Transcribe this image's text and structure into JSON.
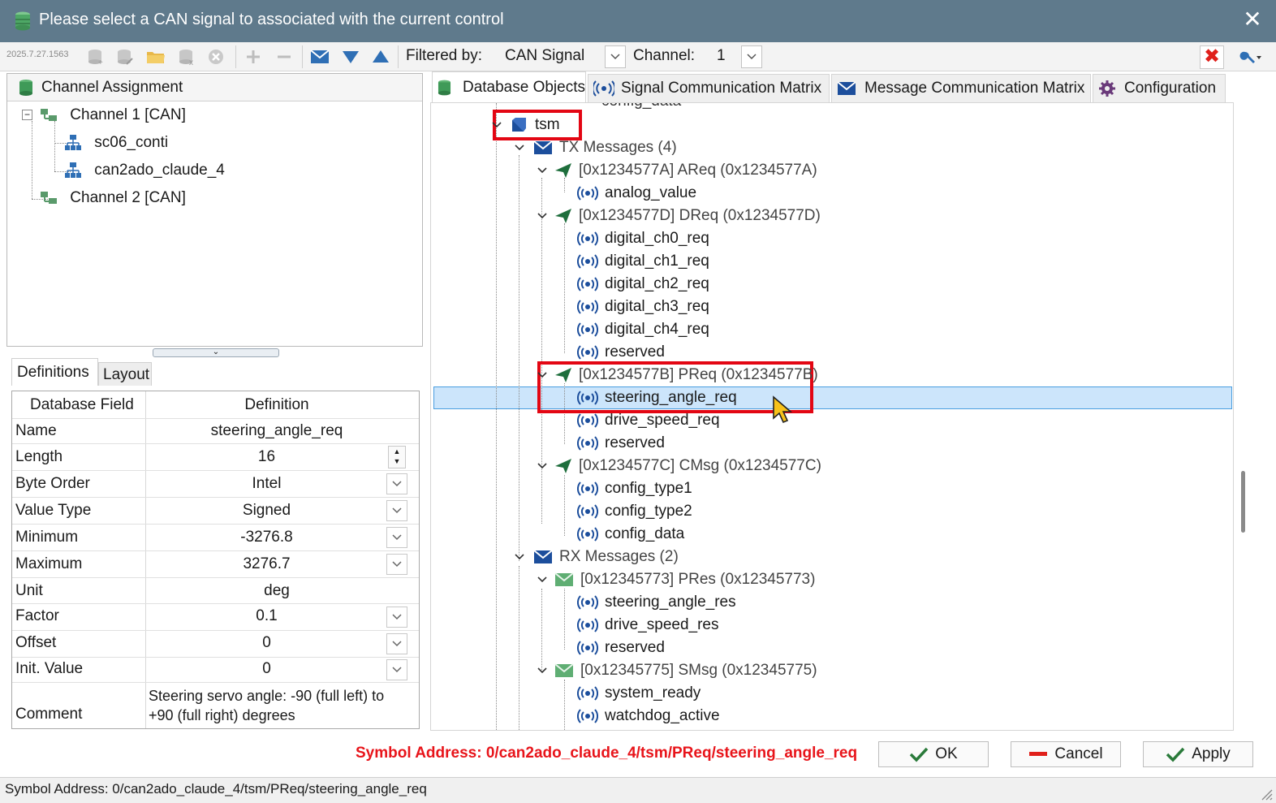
{
  "window": {
    "title": "Please select a CAN signal to associated with the current control",
    "close_glyph": "✕"
  },
  "toolbar": {
    "version": "2025.7.27.1563",
    "filtered_by_label": "Filtered by:",
    "filtered_by_value": "CAN Signal",
    "channel_label": "Channel:",
    "channel_value": "1",
    "clear_glyph": "✖"
  },
  "channel_assignment": {
    "title": "Channel Assignment",
    "items": [
      {
        "label": "Channel 1 [CAN]"
      },
      {
        "label": "sc06_conti"
      },
      {
        "label": "can2ado_claude_4"
      },
      {
        "label": "Channel 2 [CAN]"
      }
    ]
  },
  "left_tabs": {
    "definitions": "Definitions",
    "layout": "Layout"
  },
  "definitions": {
    "header_field": "Database Field",
    "header_definition": "Definition",
    "rows": [
      {
        "field": "Name",
        "value": "steering_angle_req"
      },
      {
        "field": "Length",
        "value": "16"
      },
      {
        "field": "Byte Order",
        "value": "Intel"
      },
      {
        "field": "Value Type",
        "value": "Signed"
      },
      {
        "field": "Minimum",
        "value": "-3276.8"
      },
      {
        "field": "Maximum",
        "value": "3276.7"
      },
      {
        "field": "Unit",
        "value": "deg"
      },
      {
        "field": "Factor",
        "value": "0.1"
      },
      {
        "field": "Offset",
        "value": "0"
      },
      {
        "field": "Init. Value",
        "value": "0"
      },
      {
        "field": "Comment",
        "value_line1": "Steering servo angle: -90 (full left) to",
        "value_line2": "+90 (full right) degrees"
      }
    ]
  },
  "right_tabs": [
    {
      "label": "Database Objects"
    },
    {
      "label": "Signal Communication Matrix"
    },
    {
      "label": "Message Communication Matrix"
    },
    {
      "label": "Configuration"
    }
  ],
  "tree": {
    "cut_top": "config_data",
    "node": "tsm",
    "tx": {
      "label": "TX Messages (4)",
      "messages": [
        {
          "label": "[0x1234577A] AReq (0x1234577A)",
          "signals": [
            "analog_value"
          ]
        },
        {
          "label": "[0x1234577D] DReq (0x1234577D)",
          "signals": [
            "digital_ch0_req",
            "digital_ch1_req",
            "digital_ch2_req",
            "digital_ch3_req",
            "digital_ch4_req",
            "reserved"
          ]
        },
        {
          "label": "[0x1234577B] PReq (0x1234577B)",
          "signals": [
            "steering_angle_req",
            "drive_speed_req",
            "reserved"
          ]
        },
        {
          "label": "[0x1234577C] CMsg (0x1234577C)",
          "signals": [
            "config_type1",
            "config_type2",
            "config_data"
          ]
        }
      ]
    },
    "rx": {
      "label": "RX Messages (2)",
      "messages": [
        {
          "label": "[0x12345773] PRes (0x12345773)",
          "signals": [
            "steering_angle_res",
            "drive_speed_res",
            "reserved"
          ]
        },
        {
          "label": "[0x12345775] SMsg (0x12345775)",
          "signals": [
            "system_ready",
            "watchdog_active"
          ]
        }
      ]
    }
  },
  "bottom": {
    "symbol_address": "Symbol Address: 0/can2ado_claude_4/tsm/PReq/steering_angle_req",
    "ok_label": "OK",
    "cancel_label": "Cancel",
    "apply_label": "Apply"
  },
  "statusbar": {
    "text": "Symbol Address: 0/can2ado_claude_4/tsm/PReq/steering_angle_req"
  },
  "colors": {
    "titlebar": "#5f7a8c",
    "selection": "#cce5fb",
    "highlight_box": "#e30613",
    "symbol_address": "#e8141a",
    "signal_icon": "#1c4e9c",
    "message_tx_icon": "#1e6e3c"
  }
}
